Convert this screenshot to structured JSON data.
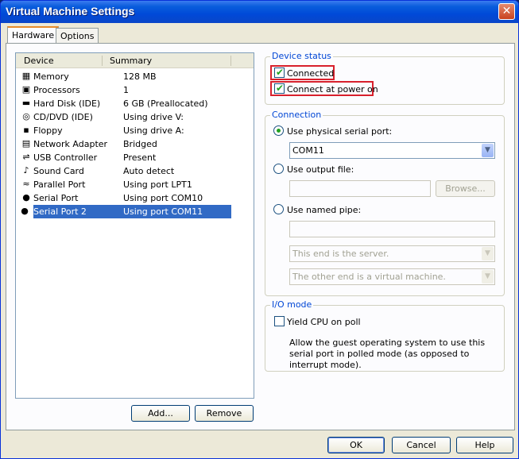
{
  "window": {
    "title": "Virtual Machine Settings",
    "close_glyph": "✕"
  },
  "tabs": [
    {
      "label": "Hardware",
      "active": true
    },
    {
      "label": "Options",
      "active": false
    }
  ],
  "device_list": {
    "columns": [
      "Device",
      "Summary"
    ],
    "rows": [
      {
        "device": "Memory",
        "summary": "128 MB",
        "icon": "memory-icon",
        "glyph": "▦"
      },
      {
        "device": "Processors",
        "summary": "1",
        "icon": "processor-icon",
        "glyph": "▣"
      },
      {
        "device": "Hard Disk (IDE)",
        "summary": "6 GB (Preallocated)",
        "icon": "hard-disk-icon",
        "glyph": "▬"
      },
      {
        "device": "CD/DVD (IDE)",
        "summary": "Using drive V:",
        "icon": "cd-dvd-icon",
        "glyph": "◎"
      },
      {
        "device": "Floppy",
        "summary": "Using drive A:",
        "icon": "floppy-icon",
        "glyph": "▪"
      },
      {
        "device": "Network Adapter",
        "summary": "Bridged",
        "icon": "network-adapter-icon",
        "glyph": "▤"
      },
      {
        "device": "USB Controller",
        "summary": "Present",
        "icon": "usb-icon",
        "glyph": "⇌"
      },
      {
        "device": "Sound Card",
        "summary": "Auto detect",
        "icon": "sound-card-icon",
        "glyph": "♪"
      },
      {
        "device": "Parallel Port",
        "summary": "Using port LPT1",
        "icon": "parallel-port-icon",
        "glyph": "≈"
      },
      {
        "device": "Serial Port",
        "summary": "Using port COM10",
        "icon": "serial-port-icon",
        "glyph": "●"
      },
      {
        "device": "Serial Port 2",
        "summary": "Using port COM11",
        "icon": "serial-port-icon",
        "glyph": "●",
        "selected": true
      }
    ],
    "add_label": "Add...",
    "remove_label": "Remove"
  },
  "device_status": {
    "title": "Device status",
    "connected_label": "Connected",
    "connected_checked": true,
    "connect_power_on_label": "Connect at power on",
    "connect_power_on_checked": true
  },
  "connection": {
    "title": "Connection",
    "physical_label": "Use physical serial port:",
    "physical_value": "COM11",
    "output_file_label": "Use output file:",
    "output_file_value": "",
    "browse_label": "Browse...",
    "named_pipe_label": "Use named pipe:",
    "named_pipe_value": "",
    "pipe_end_value": "This end is the server.",
    "pipe_other_value": "The other end is a virtual machine.",
    "selected": "physical"
  },
  "io_mode": {
    "title": "I/O mode",
    "yield_label": "Yield CPU on poll",
    "yield_checked": false,
    "description": "Allow the guest operating system to use this serial port in polled mode (as opposed to interrupt mode)."
  },
  "footer": {
    "ok_label": "OK",
    "cancel_label": "Cancel",
    "help_label": "Help"
  },
  "colors": {
    "accent": "#316ac5",
    "title_bar": "#0049d8",
    "highlight_box": "#d8202c"
  }
}
